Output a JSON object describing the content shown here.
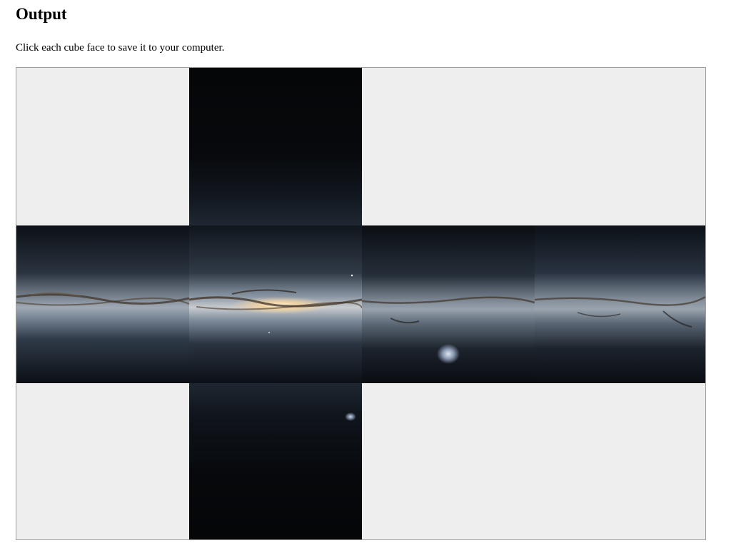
{
  "page": {
    "title": "Output",
    "instructions": "Click each cube face to save it to your computer."
  },
  "colors": {
    "empty_cell": "#eeeeee",
    "space": "#05070b",
    "band_glow": "#8fa2b8",
    "band_core": "#f4dcb4",
    "dust": "#3a2e22",
    "border": "#a0a0a0"
  },
  "cube_faces": [
    {
      "name": "top",
      "image": "milky-way-top-face"
    },
    {
      "name": "left",
      "image": "milky-way-left-face"
    },
    {
      "name": "front",
      "image": "milky-way-front-face"
    },
    {
      "name": "right",
      "image": "milky-way-right-face"
    },
    {
      "name": "back",
      "image": "milky-way-back-face"
    },
    {
      "name": "bottom",
      "image": "milky-way-bottom-face"
    }
  ]
}
